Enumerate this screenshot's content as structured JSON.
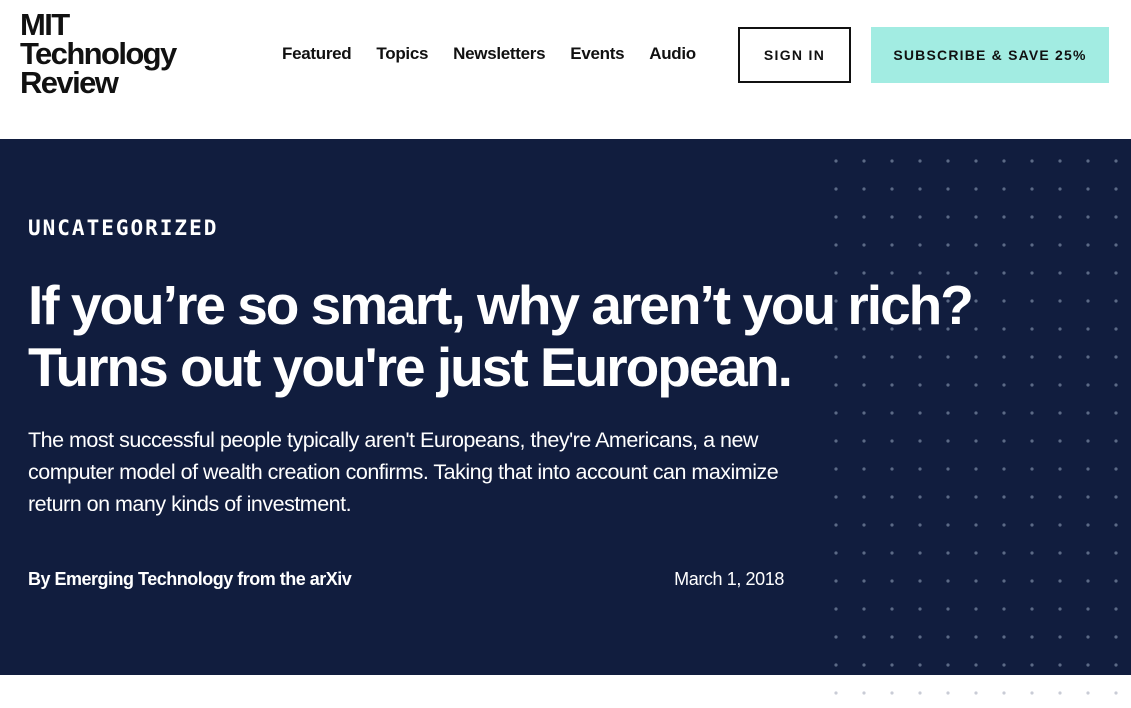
{
  "header": {
    "logo": {
      "line1": "MIT",
      "line2": "Technology",
      "line3": "Review"
    },
    "nav": [
      "Featured",
      "Topics",
      "Newsletters",
      "Events",
      "Audio"
    ],
    "sign_in_label": "SIGN IN",
    "subscribe_label": "SUBSCRIBE & SAVE 25%"
  },
  "article": {
    "category": "UNCATEGORIZED",
    "headline": "If you’re so smart, why aren’t you rich? Turns out you're just European.",
    "dek": "The most successful people typically aren't Europeans, they're Americans, a new computer model of wealth creation confirms. Taking that into account can maximize return on many kinds of investment.",
    "byline_prefix": "By",
    "author": "Emerging Technology from the arXiv",
    "date": "March 1, 2018"
  },
  "colors": {
    "hero_background": "#111d3e",
    "subscribe_accent": "#a2ece2",
    "dot_pattern": "#5c6a86"
  }
}
